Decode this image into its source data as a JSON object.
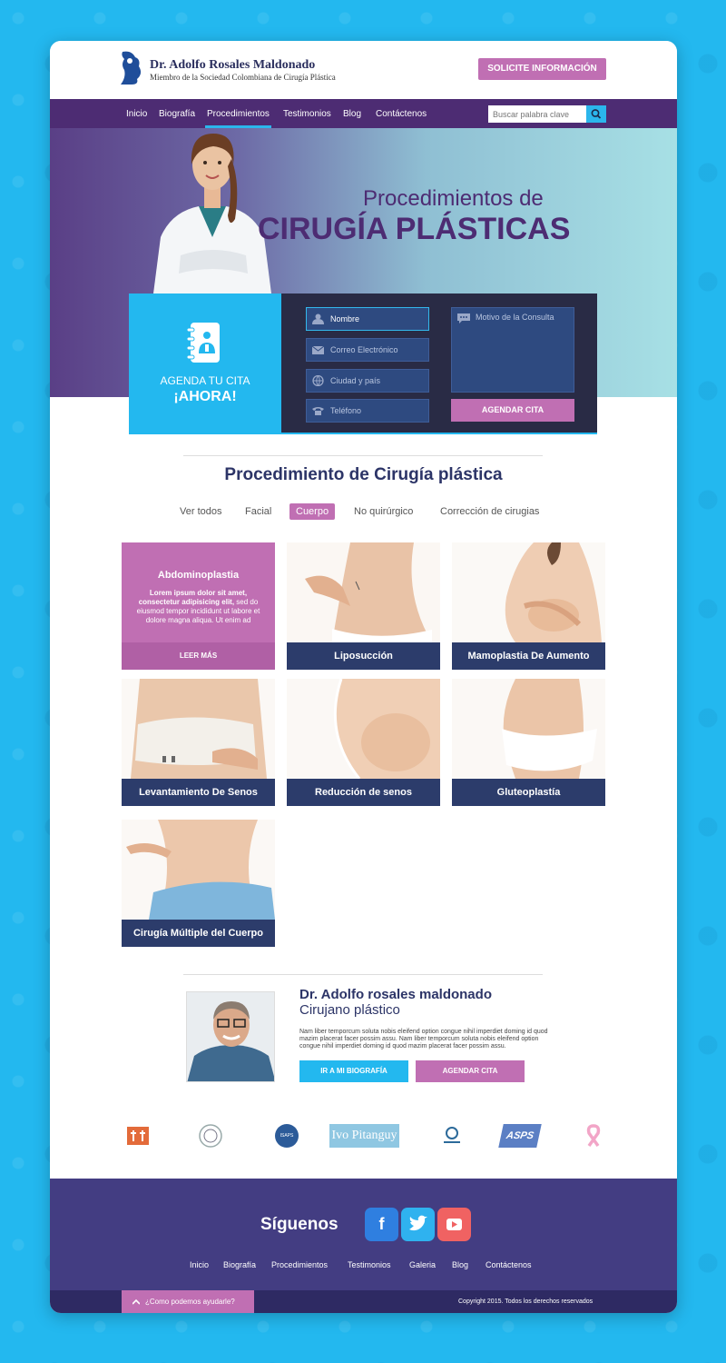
{
  "header": {
    "name": "Dr. Adolfo Rosales Maldonado",
    "subtitle": "Miembro de la Sociedad Colombiana de Cirugía Plástica",
    "cta": "SOLICITE INFORMACIÓN"
  },
  "nav": {
    "items": [
      "Inicio",
      "Biografía",
      "Procedimientos",
      "Testimonios",
      "Blog",
      "Contáctenos"
    ],
    "active": "Procedimientos",
    "search_placeholder": "Buscar palabra clave"
  },
  "hero": {
    "line1": "Procedimientos de",
    "line2": "CIRUGÍA PLÁSTICAS"
  },
  "form": {
    "agenda_line1": "AGENDA TU CITA",
    "agenda_line2": "¡AHORA!",
    "name_value": "Nombre",
    "email_placeholder": "Correo Electrónico",
    "city_placeholder": "Ciudad y país",
    "phone_placeholder": "Teléfono",
    "reason_placeholder": "Motivo de la Consulta",
    "submit": "AGENDAR CITA"
  },
  "procedures": {
    "title": "Procedimiento de Cirugía plástica",
    "filters": [
      "Ver todos",
      "Facial",
      "Cuerpo",
      "No quirúrgico",
      "Corrección de cirugias"
    ],
    "active_filter": "Cuerpo",
    "featured": {
      "title": "Abdominoplastia",
      "desc_bold": "Lorem ipsum dolor sit amet, consectetur adipisicing elit,",
      "desc": "sed do eiusmod tempor incididunt ut labore et dolore magna aliqua. Ut enim ad",
      "more": "LEER MÁS"
    },
    "items": [
      "Liposucción",
      "Mamoplastia De Aumento",
      "Levantamiento De Senos",
      "Reducción de senos",
      "Gluteoplastía",
      "Cirugía Múltiple del Cuerpo"
    ]
  },
  "bio": {
    "name": "Dr. Adolfo rosales maldonado",
    "role": "Cirujano plástico",
    "text": "Nam liber temporcum soluta nobis eleifend option congue nihil imperdiet doming id quod mazim placerat facer possim assu. Nam liber temporcum soluta nobis eleifend option congue nihil imperdiet doming id quod mazim placerat facer possim assu.",
    "btn_bio": "IR A MI BIOGRAFÍA",
    "btn_cita": "AGENDAR CITA"
  },
  "partners": {
    "pitanguy": "Ivo Pitanguy",
    "isaps": "ISAPS",
    "asps": "ASPS"
  },
  "footer": {
    "follow": "Síguenos",
    "social": [
      "f",
      "t",
      "yt"
    ],
    "links": [
      "Inicio",
      "Biografía",
      "Procedimientos",
      "Testimonios",
      "Galeria",
      "Blog",
      "Contáctenos"
    ],
    "help": "¿Como podemos ayudarle?",
    "copyright": "Copyright 2015. Todos los derechos reservados"
  },
  "colors": {
    "purple": "#4d2c73",
    "accent_pink": "#c06fb3",
    "accent_blue": "#23b8ef",
    "navy": "#2c3c6b"
  }
}
